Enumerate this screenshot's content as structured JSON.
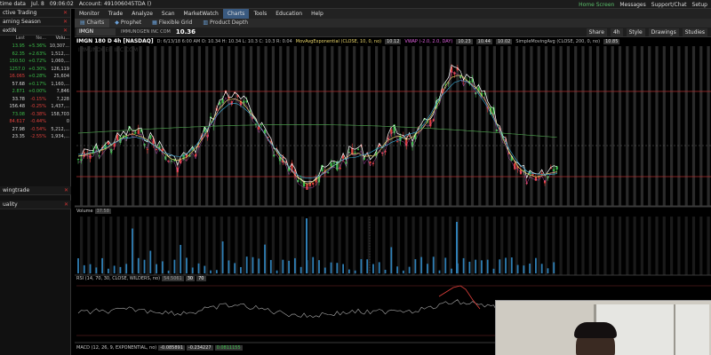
{
  "topbar": {
    "left_label": "time data",
    "date": "Jul. 8",
    "time": "09:06:02",
    "account": "Account: 491006045TDA ()",
    "right": [
      "Home Screen",
      "Messages",
      "Support/Chat",
      "Setup"
    ]
  },
  "left_panel": {
    "top_rows": [
      "ctive Trading",
      "arning Season",
      "extiN"
    ],
    "watchlist_headers": [
      "Last",
      "Ne...",
      "Volu..."
    ],
    "watchlist": [
      {
        "last": "13.95",
        "net": "+5.36%",
        "vol": "10,307...",
        "dir": "up"
      },
      {
        "last": "62.35",
        "net": "+2.63%",
        "vol": "1,512,...",
        "dir": "up"
      },
      {
        "last": "150.50",
        "net": "+0.72%",
        "vol": "1,060,...",
        "dir": "up"
      },
      {
        "last": "1257.0",
        "net": "+0.30%",
        "vol": "126,119",
        "dir": "up"
      },
      {
        "last": "16.065",
        "net": "+0.28%",
        "vol": "25,604",
        "dir": "dn"
      },
      {
        "last": "57.68",
        "net": "+0.17%",
        "vol": "1,160,...",
        "dir": "wh"
      },
      {
        "last": "2.871",
        "net": "+0.00%",
        "vol": "7,846",
        "dir": "up"
      },
      {
        "last": "33.78",
        "net": "-0.15%",
        "vol": "7,228",
        "dir": "wh"
      },
      {
        "last": "156.48",
        "net": "-0.25%",
        "vol": "1,437,...",
        "dir": "wh"
      },
      {
        "last": "73.08",
        "net": "-0.38%",
        "vol": "158,703",
        "dir": "up"
      },
      {
        "last": "84.617",
        "net": "-0.44%",
        "vol": "0",
        "dir": "dn"
      },
      {
        "last": "27.98",
        "net": "-0.54%",
        "vol": "5,212,...",
        "dir": "wh"
      },
      {
        "last": "23.35",
        "net": "-2.55%",
        "vol": "1,934,...",
        "dir": "wh"
      }
    ],
    "bottom_rows": [
      "wingtrade",
      "uality"
    ]
  },
  "menubar": {
    "items": [
      "Monitor",
      "Trade",
      "Analyze",
      "Scan",
      "MarketWatch",
      "Charts",
      "Tools",
      "Education",
      "Help"
    ],
    "active": "Charts"
  },
  "subtabs": {
    "items": [
      "Charts",
      "Prophet",
      "Flexible Grid",
      "Product Depth"
    ]
  },
  "chartbar": {
    "symbol": "IMGN",
    "description": "IMMUNOGEN INC COM",
    "price": "10.36",
    "buttons": [
      "Share",
      "4h",
      "Style",
      "Drawings",
      "Studies"
    ]
  },
  "info": {
    "main": "IMGN 180 D 4h [NASDAQ]",
    "ohlc": "D: 6/13/18 6:00 AM  O: 10.34  H: 10.34  L: 10.3  C: 10.3  R: 0.04",
    "ma1": "MovAvgExponential (CLOSE, 10, 0, no)",
    "ma1_val": "10.12",
    "vwap": "VWAP (-2.0, 2.0, DAY)",
    "vwap_val1": "10.23",
    "vwap_val2": "10.44",
    "vwap_val3": "10.02",
    "ma2": "SimpleMovingAvg (CLOSE, 200, 0, no)",
    "ma2_val": "10.85",
    "watermark": "IMMUNOGEN INC COM"
  },
  "volume_panel": {
    "label": "Volume",
    "value": "37.58"
  },
  "rsi_panel": {
    "label": "RSI (14, 70, 30, CLOSE, WILDERS, no)",
    "value": "54.5061",
    "ob": "30",
    "os": "70"
  },
  "macd_panel": {
    "label": "MACD (12, 26, 9, EXPONENTIAL, no)",
    "v1": "-0.085891",
    "v2": "-0.234227",
    "v3": "0.0811155"
  },
  "colors": {
    "up": "#3cbc4a",
    "down": "#e0403c",
    "accent": "#3a5a80"
  }
}
